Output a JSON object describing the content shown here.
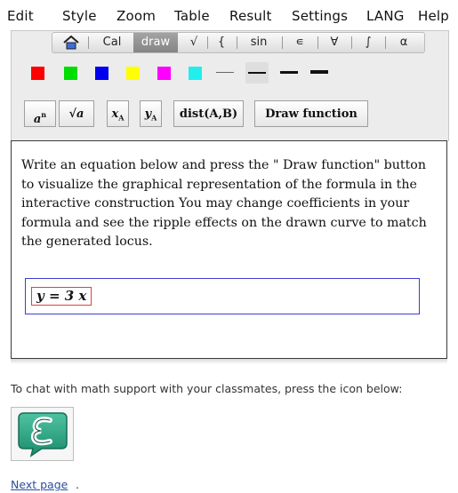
{
  "menubar": {
    "items": [
      "Edit",
      "Style",
      "Zoom",
      "Table",
      "Result",
      "Settings",
      "LANG",
      "Help"
    ]
  },
  "tabs": {
    "home_icon": "home-icon",
    "items": [
      "Cal",
      "draw",
      "√",
      "{",
      "sin",
      "∊",
      "∀",
      "∫",
      "α"
    ],
    "active": "draw"
  },
  "colors": {
    "swatches": [
      "#ff0000",
      "#00dd00",
      "#0000ee",
      "#ffff00",
      "#ff00ff",
      "#22eeee"
    ],
    "equation_border": "#3d3dd0",
    "equation_highlight": "#e04040",
    "link": "#2a4f9e"
  },
  "line_styles": {
    "selected_index": 1
  },
  "tools": {
    "power_base": "a",
    "power_exp": "n",
    "sqrt": "√a",
    "x_sub_base": "x",
    "x_sub": "A",
    "y_sub_base": "y",
    "y_sub": "A",
    "dist": "dist(A,B)",
    "draw_function": "Draw function"
  },
  "content": {
    "instructions": "Write an equation below and press the \" Draw function\" button to visualize the graphical representation of the formula in the interactive construction You may change coefficients in your formula and see the ripple effects on the drawn curve to match the generated locus.",
    "equation": "y = 3 x"
  },
  "footer": {
    "chat_text": "To chat with math support with your classmates, press the icon below:",
    "chat_icon": "chat-e-icon",
    "next_link": "Next page",
    "next_link_suffix": "."
  }
}
